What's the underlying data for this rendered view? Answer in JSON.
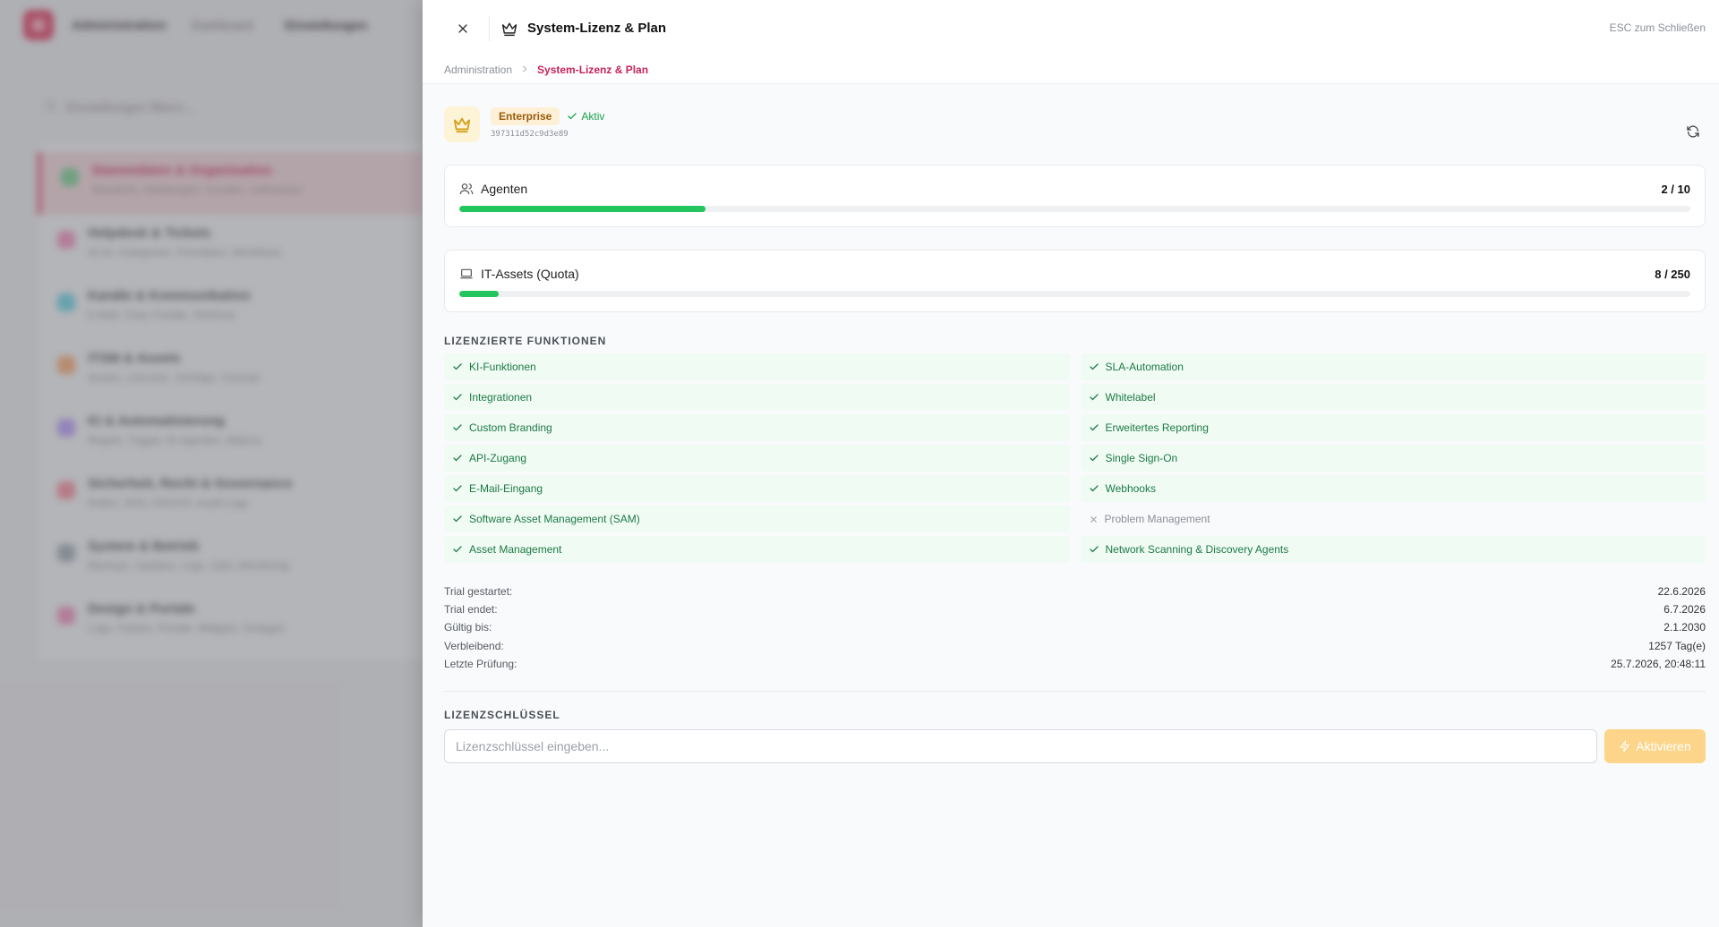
{
  "background": {
    "brand": "Administration",
    "tabs": [
      "Dashboard",
      "Einstellungen"
    ],
    "search_placeholder": "Einstellungen filtern...",
    "items": [
      {
        "title": "Stammdaten & Organisation",
        "subtitle": "Standorte, Abteilungen, Kunden, Lieferanten",
        "color": "#22c55e",
        "selected": true
      },
      {
        "title": "Helpdesk & Tickets",
        "subtitle": "SLAs, Kategorien, Prioritäten, Workflows",
        "color": "#ec4899",
        "selected": false
      },
      {
        "title": "Kanäle & Kommunikation",
        "subtitle": "E-Mail, Chat, Portale, Telefonie",
        "color": "#06b6d4",
        "selected": false
      },
      {
        "title": "ITSM & Assets",
        "subtitle": "Assets, Lizenzen, Verträge, Inventar",
        "color": "#f97316",
        "selected": false
      },
      {
        "title": "KI & Automatisierung",
        "subtitle": "Regeln, Trigger, KI-Agenten, Makros",
        "color": "#8b5cf6",
        "selected": false
      },
      {
        "title": "Sicherheit, Recht & Governance",
        "subtitle": "Rollen, SSO, DSGVO, Audit-Logs",
        "color": "#f43f5e",
        "selected": false
      },
      {
        "title": "System & Betrieb",
        "subtitle": "Backups, Updates, Logs, Jobs, Monitoring",
        "color": "#64748b",
        "selected": false
      },
      {
        "title": "Design & Portale",
        "subtitle": "Logo, Farben, Portale, Widgets, Vorlagen",
        "color": "#ec4899",
        "selected": false
      }
    ]
  },
  "panel": {
    "title": "System-Lizenz & Plan",
    "esc_hint": "ESC zum Schließen",
    "breadcrumb": {
      "root": "Administration",
      "current": "System-Lizenz & Plan"
    }
  },
  "plan": {
    "name": "Enterprise",
    "status": "Aktiv",
    "license_id": "397311d52c9d3e89"
  },
  "quotas": [
    {
      "label": "Agenten",
      "value_text": "2 / 10",
      "used": 2,
      "total": 10,
      "icon": "users-icon"
    },
    {
      "label": "IT-Assets (Quota)",
      "value_text": "8 / 250",
      "used": 8,
      "total": 250,
      "icon": "laptop-icon"
    }
  ],
  "features_title": "LIZENZIERTE FUNKTIONEN",
  "features": [
    {
      "label": "KI-Funktionen",
      "enabled": true
    },
    {
      "label": "SLA-Automation",
      "enabled": true
    },
    {
      "label": "Integrationen",
      "enabled": true
    },
    {
      "label": "Whitelabel",
      "enabled": true
    },
    {
      "label": "Custom Branding",
      "enabled": true
    },
    {
      "label": "Erweitertes Reporting",
      "enabled": true
    },
    {
      "label": "API-Zugang",
      "enabled": true
    },
    {
      "label": "Single Sign-On",
      "enabled": true
    },
    {
      "label": "E-Mail-Eingang",
      "enabled": true
    },
    {
      "label": "Webhooks",
      "enabled": true
    },
    {
      "label": "Software Asset Management (SAM)",
      "enabled": true
    },
    {
      "label": "Problem Management",
      "enabled": false
    },
    {
      "label": "Asset Management",
      "enabled": true
    },
    {
      "label": "Network Scanning & Discovery Agents",
      "enabled": true
    }
  ],
  "meta": [
    {
      "label": "Trial gestartet:",
      "value": "22.6.2026"
    },
    {
      "label": "Trial endet:",
      "value": "6.7.2026"
    },
    {
      "label": "Gültig bis:",
      "value": "2.1.2030"
    },
    {
      "label": "Verbleibend:",
      "value": "1257 Tag(e)"
    },
    {
      "label": "Letzte Prüfung:",
      "value": "25.7.2026, 20:48:11"
    }
  ],
  "license_key": {
    "title": "LIZENZSCHLÜSSEL",
    "placeholder": "Lizenzschlüssel eingeben...",
    "value": "",
    "button": "Aktivieren"
  },
  "colors": {
    "accent": "#c8235a",
    "success": "#22c55e",
    "gold": "#d4a017",
    "activate": "#fcd58a"
  }
}
